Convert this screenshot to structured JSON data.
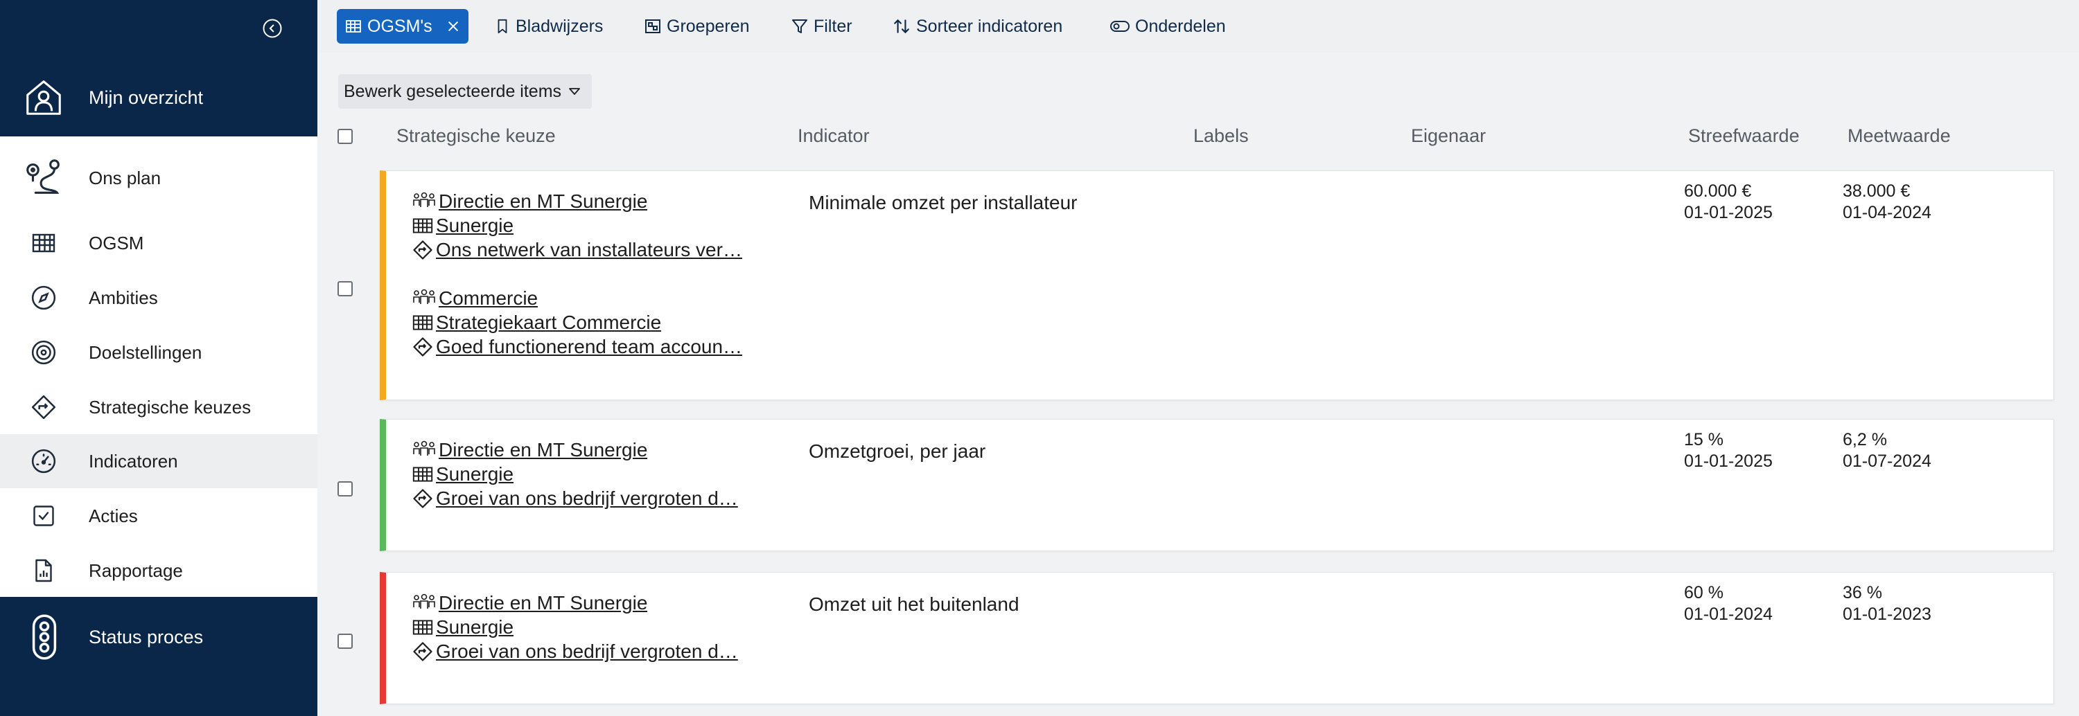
{
  "sidebar": {
    "top": {
      "label": "Mijn overzicht",
      "icon": "home-person-icon"
    },
    "items": [
      {
        "label": "Ons plan",
        "icon": "route-icon"
      },
      {
        "label": "OGSM",
        "icon": "table-icon"
      },
      {
        "label": "Ambities",
        "icon": "compass-icon"
      },
      {
        "label": "Doelstellingen",
        "icon": "target-icon"
      },
      {
        "label": "Strategische keuzes",
        "icon": "direction-sign-icon"
      },
      {
        "label": "Indicatoren",
        "icon": "gauge-icon"
      },
      {
        "label": "Acties",
        "icon": "checkbox-icon"
      },
      {
        "label": "Rapportage",
        "icon": "report-icon"
      }
    ],
    "bottom": {
      "label": "Status proces",
      "icon": "traffic-light-icon"
    },
    "active_item": "Indicatoren"
  },
  "toolbar": {
    "chip": "OGSM's",
    "bookmarks": "Bladwijzers",
    "group": "Groeperen",
    "filter": "Filter",
    "sort": "Sorteer indicatoren",
    "parts": "Onderdelen"
  },
  "bulk_action": "Bewerk geselecteerde items",
  "columns": {
    "strategic": "Strategische keuze",
    "indicator": "Indicator",
    "labels": "Labels",
    "owner": "Eigenaar",
    "target": "Streefwaarde",
    "measured": "Meetwaarde"
  },
  "rows": [
    {
      "status_color": "#f7a823",
      "links": [
        {
          "team": "Directie en MT Sunergie",
          "plan": "Sunergie",
          "choice": "Ons netwerk van installateurs ver…"
        },
        {
          "team": "Commercie",
          "plan": "Strategiekaart Commercie",
          "choice": "Goed functionerend team accoun…"
        }
      ],
      "indicator": "Minimale omzet per installateur",
      "target_value": "60.000 €",
      "target_date": "01-01-2025",
      "measured_value": "38.000 €",
      "measured_date": "01-04-2024"
    },
    {
      "status_color": "#5cb85c",
      "links": [
        {
          "team": "Directie en MT Sunergie",
          "plan": "Sunergie",
          "choice": "Groei van ons bedrijf vergroten d…"
        }
      ],
      "indicator": "Omzetgroei, per jaar",
      "target_value": "15 %",
      "target_date": "01-01-2025",
      "measured_value": "6,2 %",
      "measured_date": "01-07-2024"
    },
    {
      "status_color": "#e53935",
      "links": [
        {
          "team": "Directie en MT Sunergie",
          "plan": "Sunergie",
          "choice": "Groei van ons bedrijf vergroten d…"
        }
      ],
      "indicator": "Omzet uit het buitenland",
      "target_value": "60 %",
      "target_date": "01-01-2024",
      "measured_value": "36 %",
      "measured_date": "01-01-2023"
    }
  ]
}
